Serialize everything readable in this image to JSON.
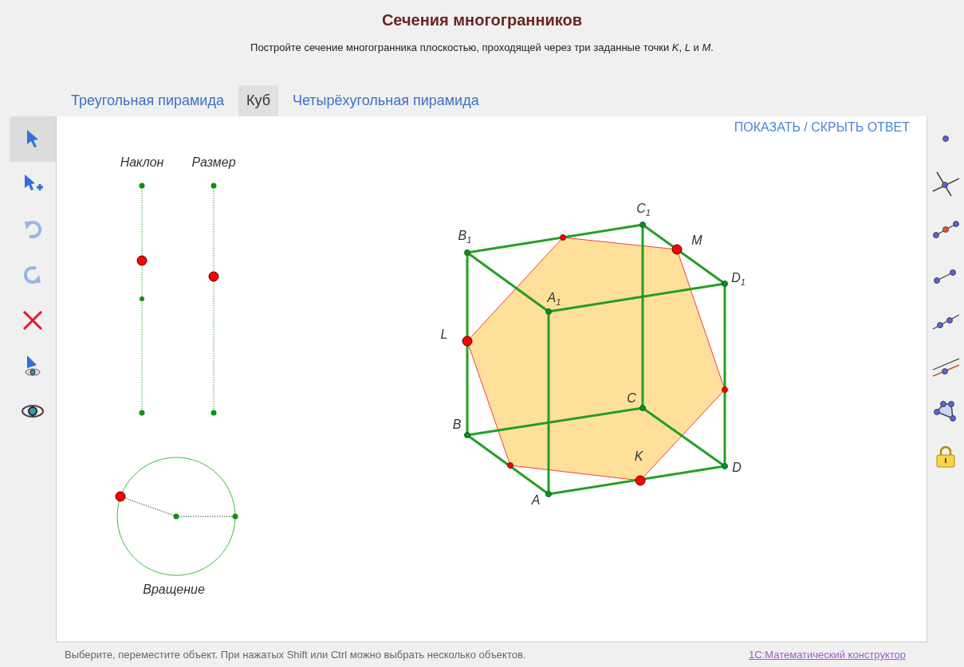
{
  "header": {
    "title": "Сечения многогранников",
    "subtitle": "Постройте сечение многогранника плоскостью, проходящей через три заданные точки *K*, *L* и *M*."
  },
  "tabs": [
    {
      "label": "Треугольная пирамида",
      "selected": false
    },
    {
      "label": "Куб",
      "selected": true
    },
    {
      "label": "Четырёхугольная пирамида",
      "selected": false
    }
  ],
  "left_toolbar": [
    {
      "kind": "select",
      "selected": true,
      "disabled": false
    },
    {
      "kind": "select_add",
      "selected": false,
      "disabled": false
    },
    {
      "kind": "undo",
      "selected": false,
      "disabled": true
    },
    {
      "kind": "redo",
      "selected": false,
      "disabled": true
    },
    {
      "kind": "delete",
      "selected": false,
      "disabled": false
    },
    {
      "kind": "show_label",
      "selected": false,
      "disabled": false
    },
    {
      "kind": "show_object",
      "selected": false,
      "disabled": false
    }
  ],
  "canvas": {
    "answer_toggle": "ПОКАЗАТЬ / СКРЫТЬ ОТВЕТ",
    "sliders": [
      {
        "label": "Наклон",
        "level": 0.67
      },
      {
        "label": "Размер",
        "level": 0.6
      }
    ],
    "rotation_label": "Вращение",
    "points": [
      {
        "label": "C$_{1}$",
        "kind": "vertex"
      },
      {
        "label": "B$_{1}$",
        "kind": "vertex"
      },
      {
        "label": "M",
        "kind": "given"
      },
      {
        "label": "D$_{1}$",
        "kind": "vertex"
      },
      {
        "label": "A$_{1}$",
        "kind": "vertex"
      },
      {
        "label": "L",
        "kind": "given"
      },
      {
        "label": "C",
        "kind": "vertex"
      },
      {
        "label": "B",
        "kind": "vertex"
      },
      {
        "label": "K",
        "kind": "given"
      },
      {
        "label": "D",
        "kind": "vertex"
      },
      {
        "label": "A",
        "kind": "vertex"
      }
    ]
  },
  "right_toolbar": [
    {
      "kind": "point"
    },
    {
      "kind": "intersect"
    },
    {
      "kind": "midpoint"
    },
    {
      "kind": "segment"
    },
    {
      "kind": "line"
    },
    {
      "kind": "parallel"
    },
    {
      "kind": "polygon"
    },
    {
      "kind": "lock"
    }
  ],
  "status_bar": {
    "hint": "Выберите, переместите объект. При нажатых Shift или Ctrl можно выбрать несколько объектов.",
    "link": "1С:Математический конструктор"
  }
}
